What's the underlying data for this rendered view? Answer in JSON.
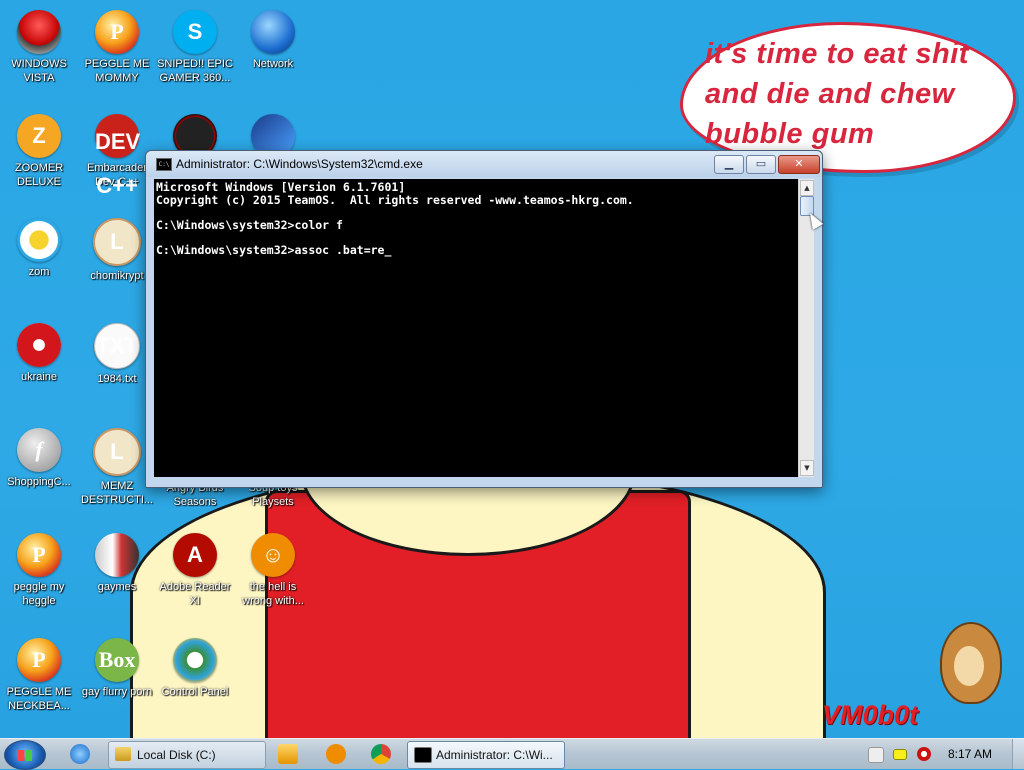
{
  "wallpaper": {
    "bubble_text": "it's time to eat shit and die and chew bubble gum",
    "signature": "VM0b0t"
  },
  "desktop_icons": [
    {
      "label": "WINDOWS VISTA",
      "icon": "windows-vista-icon"
    },
    {
      "label": "PEGGLE ME MOMMY",
      "icon": "peggle-icon"
    },
    {
      "label": "SNIPED!! EPIC GAMER 360...",
      "icon": "skype-icon"
    },
    {
      "label": "Network",
      "icon": "network-globe-icon"
    },
    {
      "label": "ZOOMER DELUXE",
      "icon": "zuma-icon"
    },
    {
      "label": "Embarcader Dev-C++",
      "icon": "dev-cpp-icon"
    },
    {
      "label": "zom",
      "icon": "flower-icon"
    },
    {
      "label": "chomikrypt",
      "icon": "shortcut-l-icon"
    },
    {
      "label": "ukraine",
      "icon": "radiation-icon"
    },
    {
      "label": "1984.txt",
      "icon": "text-file-icon"
    },
    {
      "label": "ShoppingC...",
      "icon": "flash-icon"
    },
    {
      "label": "MEMZ DESTRUCTI...",
      "icon": "shortcut-l-icon"
    },
    {
      "label": "Angry Birds Seasons",
      "icon": "angry-birds-icon"
    },
    {
      "label": "Soup toys Playsets",
      "icon": "playsets-icon"
    },
    {
      "label": "peggle my heggle",
      "icon": "peggle-icon"
    },
    {
      "label": "gaymes",
      "icon": "book-icon"
    },
    {
      "label": "Adobe Reader XI",
      "icon": "adobe-reader-icon"
    },
    {
      "label": "the hell is wrong with...",
      "icon": "uc-browser-icon"
    },
    {
      "label": "PEGGLE ME NECKBEA...",
      "icon": "peggle-icon"
    },
    {
      "label": "gay flurry porn",
      "icon": "box-icon"
    },
    {
      "label": "Control Panel",
      "icon": "control-panel-icon"
    }
  ],
  "cmd_window": {
    "title": "Administrator: C:\\Windows\\System32\\cmd.exe",
    "icon_text": "C:\\",
    "minimize_symbol": "▁",
    "maximize_symbol": "▭",
    "close_symbol": "✕",
    "lines": [
      "Microsoft Windows [Version 6.1.7601]",
      "Copyright (c) 2015 TeamOS.  All rights reserved -www.teamos-hkrg.com.",
      "",
      "C:\\Windows\\system32>color f",
      "",
      "C:\\Windows\\system32>assoc .bat=re_"
    ],
    "scroll_up_symbol": "▲",
    "scroll_down_symbol": "▼"
  },
  "taskbar": {
    "tasks": [
      {
        "label": "Local Disk (C:)"
      },
      {
        "label": "Administrator: C:\\Wi..."
      }
    ],
    "clock": "8:17 AM"
  }
}
